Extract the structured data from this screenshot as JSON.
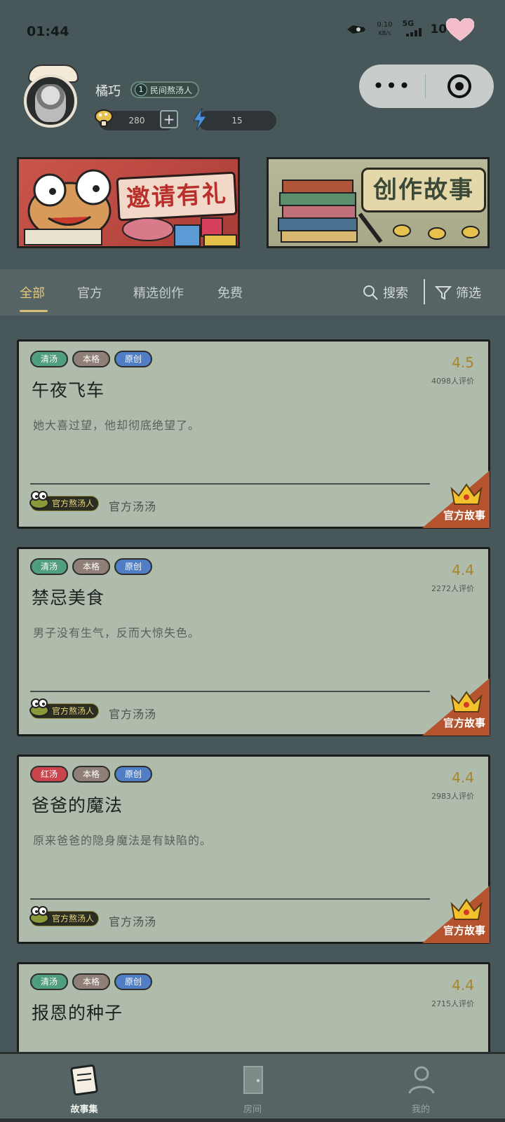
{
  "status": {
    "time": "01:44",
    "net_speed_value": "0.10",
    "net_speed_unit": "KB/s",
    "network": "5G",
    "battery": "100%"
  },
  "profile": {
    "username": "橘巧",
    "level": "1",
    "title": "民间熬汤人",
    "coins": "280",
    "energy": "15"
  },
  "banners": {
    "invite": "邀请有礼",
    "create": "创作故事"
  },
  "tabs": [
    {
      "label": "全部"
    },
    {
      "label": "官方"
    },
    {
      "label": "精选创作"
    },
    {
      "label": "免费"
    }
  ],
  "tools": {
    "search": "搜索",
    "filter": "筛选"
  },
  "cards": [
    {
      "tags": [
        "清汤",
        "本格",
        "原创"
      ],
      "rating": "4.5",
      "rating_count": "4098人评价",
      "title": "午夜飞车",
      "desc": "她大喜过望，他却彻底绝望了。",
      "author_badge": "官方熬汤人",
      "author": "官方汤汤",
      "corner": "官方故事"
    },
    {
      "tags": [
        "清汤",
        "本格",
        "原创"
      ],
      "rating": "4.4",
      "rating_count": "2272人评价",
      "title": "禁忌美食",
      "desc": "男子没有生气，反而大惊失色。",
      "author_badge": "官方熬汤人",
      "author": "官方汤汤",
      "corner": "官方故事"
    },
    {
      "tags": [
        "红汤",
        "本格",
        "原创"
      ],
      "rating": "4.4",
      "rating_count": "2983人评价",
      "title": "爸爸的魔法",
      "desc": "原来爸爸的隐身魔法是有缺陷的。",
      "author_badge": "官方熬汤人",
      "author": "官方汤汤",
      "corner": "官方故事"
    },
    {
      "tags": [
        "清汤",
        "本格",
        "原创"
      ],
      "rating": "4.4",
      "rating_count": "2715人评价",
      "title": "报恩的种子",
      "desc": "",
      "author_badge": "",
      "author": "",
      "corner": ""
    }
  ],
  "bottom_nav": [
    {
      "label": "故事集",
      "icon": "story-book-icon"
    },
    {
      "label": "房间",
      "icon": "door-icon"
    },
    {
      "label": "我的",
      "icon": "person-icon"
    }
  ],
  "colors": {
    "background": "#48585a",
    "card": "#b0bcab",
    "accent_gold": "#d8bf75",
    "corner_ribbon": "#b5532e"
  }
}
